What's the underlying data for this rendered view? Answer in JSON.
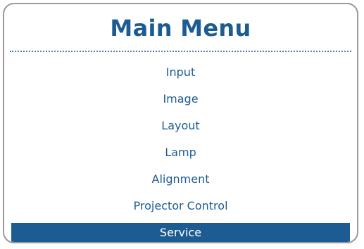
{
  "window": {
    "title": "Main Menu"
  },
  "menu": {
    "items": [
      {
        "label": "Input"
      },
      {
        "label": "Image"
      },
      {
        "label": "Layout"
      },
      {
        "label": "Lamp"
      },
      {
        "label": "Alignment"
      },
      {
        "label": "Projector Control"
      },
      {
        "label": "Service"
      }
    ],
    "selected_label": "Service"
  },
  "colors": {
    "accent": "#1d5c93",
    "selected_text": "#ffffff",
    "border": "#9a9a9a"
  }
}
